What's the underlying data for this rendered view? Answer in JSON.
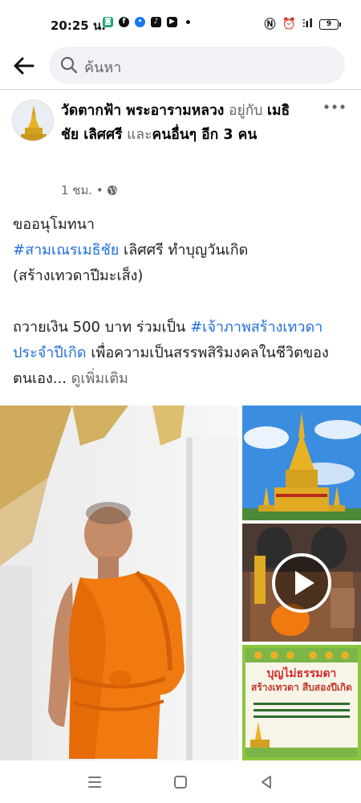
{
  "status_bar": {
    "time": "20:25 น.",
    "battery": "9"
  },
  "search": {
    "placeholder": "ค้นหา"
  },
  "post": {
    "page_name": "วัดตากฟ้า พระอารามหลวง",
    "with_text": "อยู่กับ",
    "tagged_person": "เมธิชัย เลิศศรี",
    "and_text": "และ",
    "others": "คนอื่นๆ อีก 3 คน",
    "time_ago": "1 ชม. •",
    "text": {
      "line1": "ขออนุโมทนา",
      "hashtag1": "#สามเณรเมธิชัย",
      "line2_rest": " เลิศศรี ทำบุญวันเกิด",
      "line3": "(สร้างเทวดาปีมะเส็ง)",
      "line4_start": "ถวายเงิน 500 บาท ร่วมเป็น ",
      "hashtag2": "#เจ้าภาพสร้างเทวดาประจำปีเกิด",
      "line4_rest": "  เพื่อความเป็นสรรพสิริมงคลในชีวิตของตนเอง...",
      "see_more": " ดูเพิ่มเติม"
    },
    "banner": {
      "title": "บุญไม่ธรรมดา",
      "subtitle": "สร้างเทวดา สืบสองปีเกิด"
    }
  },
  "colors": {
    "link": "#216fdb",
    "robe": "#f07a10",
    "gold": "#e8b323"
  }
}
